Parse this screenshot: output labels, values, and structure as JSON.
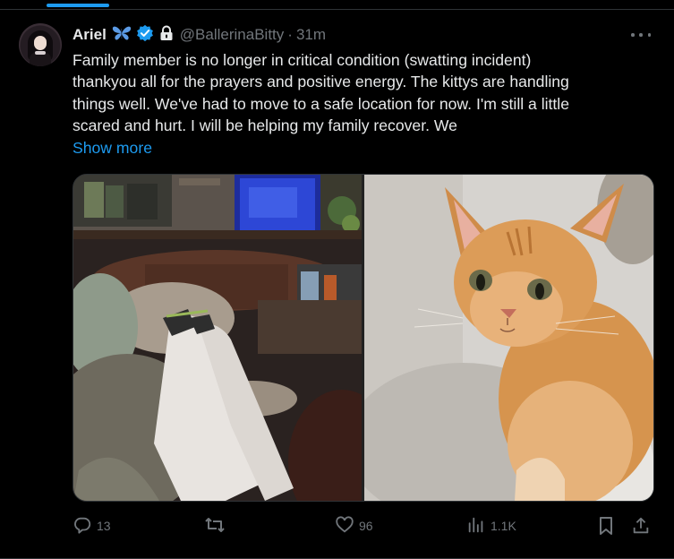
{
  "tweet": {
    "author": {
      "display_name": "Ariel",
      "handle": "@BallerinaBitty",
      "separator": "·",
      "time": "31m"
    },
    "text": "Family member is no longer in critical condition (swatting incident)\nthankyou all for the prayers and positive energy. The kittys are handling\nthings well. We've had to move to a safe location for now. I'm still a little\nscared and hurt. I will be helping my family recover. We",
    "show_more": "Show more",
    "media": [
      {
        "icon": "photo-legs-on-couch"
      },
      {
        "icon": "photo-orange-tabby-cat"
      }
    ],
    "stats": {
      "replies": "13",
      "reposts": "",
      "likes": "96",
      "views": "1.1K"
    },
    "icons": {
      "badge_1": "butterfly-icon",
      "badge_2": "verified-icon",
      "badge_3": "lock-icon",
      "more": "more-icon",
      "reply": "reply-icon",
      "repost": "repost-icon",
      "like": "like-icon",
      "views": "views-icon",
      "bookmark": "bookmark-icon",
      "share": "share-icon"
    },
    "colors": {
      "background": "#000000",
      "text": "#e7e9ea",
      "muted": "#71767b",
      "accent": "#1d9bf0",
      "border": "#2f3336"
    }
  }
}
